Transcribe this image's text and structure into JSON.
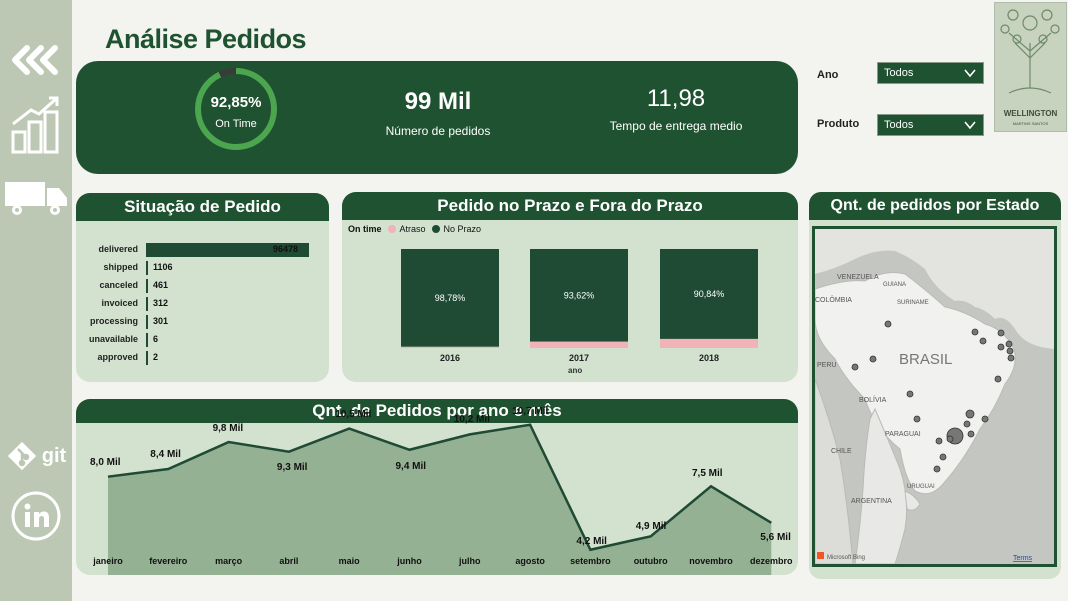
{
  "title": "Análise Pedidos",
  "kpis": {
    "on_time_value": "92,85%",
    "on_time_label": "On Time",
    "on_time_fraction": 0.9285,
    "orders_value": "99 Mil",
    "orders_label": "Número de pedidos",
    "delivery_value": "11,98",
    "delivery_label": "Tempo de entrega medio"
  },
  "filters": {
    "ano_label": "Ano",
    "ano_value": "Todos",
    "produto_label": "Produto",
    "produto_value": "Todos"
  },
  "logo": {
    "name": "WELLINGTON",
    "sub": "MARTINS SANTOS"
  },
  "sidebar": {
    "git_label": "git"
  },
  "status": {
    "title": "Situação de Pedido",
    "rows": [
      {
        "label": "delivered",
        "value": "96478",
        "n": 96478
      },
      {
        "label": "shipped",
        "value": "1106",
        "n": 1106
      },
      {
        "label": "canceled",
        "value": "461",
        "n": 461
      },
      {
        "label": "invoiced",
        "value": "312",
        "n": 312
      },
      {
        "label": "processing",
        "value": "301",
        "n": 301
      },
      {
        "label": "unavailable",
        "value": "6",
        "n": 6
      },
      {
        "label": "approved",
        "value": "2",
        "n": 2
      }
    ]
  },
  "prazo": {
    "title": "Pedido no Prazo e Fora do Prazo",
    "legend_title": "On time",
    "legend": [
      {
        "name": "Atraso",
        "color": "#f1b3b8"
      },
      {
        "name": "No Prazo",
        "color": "#1f4a33"
      }
    ],
    "xlabel": "ano"
  },
  "monthly": {
    "title": "Qnt. de Pedidos por ano e mês"
  },
  "map": {
    "title": "Qnt. de pedidos por Estado",
    "country_labels": [
      "VENEZUELA",
      "COLÔMBIA",
      "GUIANA",
      "SURINAME",
      "PERU",
      "BRASIL",
      "BOLÍVIA",
      "PARAGUAI",
      "CHILE",
      "ARGENTINA",
      "URUGUAI"
    ],
    "attribution": "Microsoft Bing",
    "terms": "Terms"
  },
  "colors": {
    "primary": "#1f5230",
    "card": "#d3e2cf",
    "sidebar": "#bcc8b3",
    "delay": "#f1b3b8"
  },
  "chart_data": [
    {
      "type": "bar",
      "title": "Situação de Pedido",
      "categories": [
        "delivered",
        "shipped",
        "canceled",
        "invoiced",
        "processing",
        "unavailable",
        "approved"
      ],
      "values": [
        96478,
        1106,
        461,
        312,
        301,
        6,
        2
      ]
    },
    {
      "type": "bar",
      "title": "Pedido no Prazo e Fora do Prazo",
      "xlabel": "ano",
      "categories": [
        "2016",
        "2017",
        "2018"
      ],
      "series": [
        {
          "name": "No Prazo",
          "values": [
            98.78,
            93.62,
            90.84
          ],
          "labels": [
            "98,78%",
            "93,62%",
            "90,84%"
          ]
        },
        {
          "name": "Atraso",
          "values": [
            1.22,
            6.38,
            9.16
          ]
        }
      ],
      "legend": "top-left"
    },
    {
      "type": "area",
      "title": "Qnt. de Pedidos por ano e mês",
      "categories": [
        "janeiro",
        "fevereiro",
        "março",
        "abril",
        "maio",
        "junho",
        "julho",
        "agosto",
        "setembro",
        "outubro",
        "novembro",
        "dezembro"
      ],
      "values": [
        8.0,
        8.4,
        9.8,
        9.3,
        10.5,
        9.4,
        10.2,
        10.7,
        4.2,
        4.9,
        7.5,
        5.6
      ],
      "labels": [
        "8,0 Mil",
        "8,4 Mil",
        "9,8 Mil",
        "9,3 Mil",
        "10,5 Mil",
        "9,4 Mil",
        "10,2 Mil",
        "10,7 Mil",
        "4,2 Mil",
        "4,9 Mil",
        "7,5 Mil",
        "5,6 Mil"
      ],
      "ylim": [
        3.2,
        11
      ]
    }
  ]
}
